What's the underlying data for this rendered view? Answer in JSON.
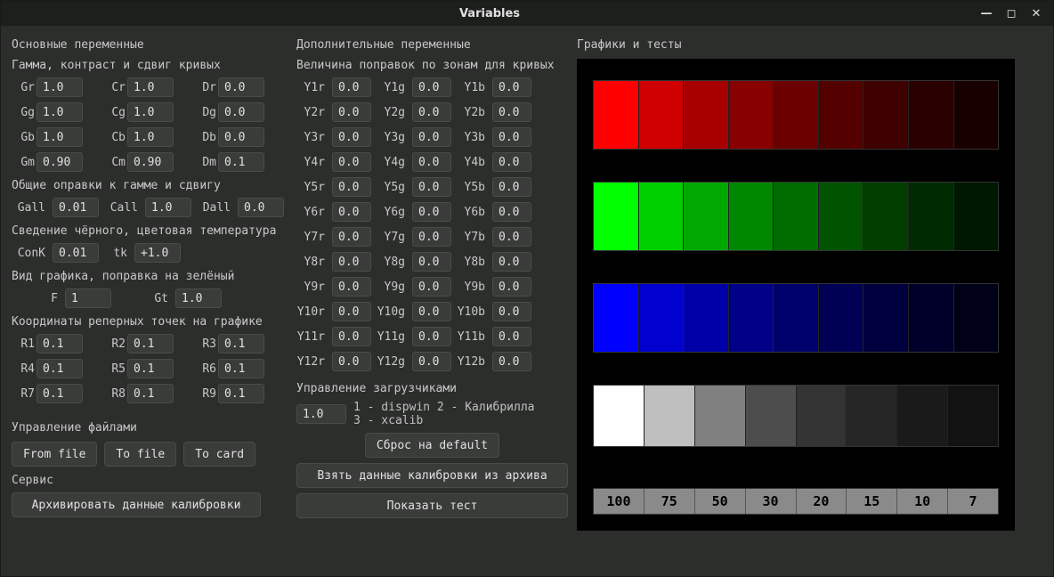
{
  "window": {
    "title": "Variables"
  },
  "col1": {
    "title": "Основные переменные",
    "gamma_title": "Гамма, контраст и сдвиг кривых",
    "gr_l": "Gr",
    "gr": "1.0",
    "cr_l": "Cr",
    "cr": "1.0",
    "dr_l": "Dr",
    "dr": "0.0",
    "gg_l": "Gg",
    "gg": "1.0",
    "cg_l": "Cg",
    "cg": "1.0",
    "dg_l": "Dg",
    "dg": "0.0",
    "gb_l": "Gb",
    "gb": "1.0",
    "cb_l": "Cb",
    "cb": "1.0",
    "db_l": "Db",
    "db": "0.0",
    "gm_l": "Gm",
    "gm": "0.90",
    "cm_l": "Cm",
    "cm": "0.90",
    "dm_l": "Dm",
    "dm": "0.1",
    "common_title": "Общие оправки к гамме и сдвигу",
    "gall_l": "Gall",
    "gall": "0.01",
    "call_l": "Call",
    "call": "1.0",
    "dall_l": "Dall",
    "dall": "0.0",
    "black_title": "Сведение чёрного, цветовая температура",
    "conk_l": "ConK",
    "conk": "0.01",
    "tk_l": "tk",
    "tk": "+1.0",
    "view_title": "Вид графика, поправка на зелёный",
    "f_l": "F",
    "f": "1",
    "gt_l": "Gt",
    "gt": "1.0",
    "coord_title": "Координаты реперных точек на графике",
    "r1_l": "R1",
    "r1": "0.1",
    "r2_l": "R2",
    "r2": "0.1",
    "r3_l": "R3",
    "r3": "0.1",
    "r4_l": "R4",
    "r4": "0.1",
    "r5_l": "R5",
    "r5": "0.1",
    "r6_l": "R6",
    "r6": "0.1",
    "r7_l": "R7",
    "r7": "0.1",
    "r8_l": "R8",
    "r8": "0.1",
    "r9_l": "R9",
    "r9": "0.1",
    "files_title": "Управление файлами",
    "from_file": "From file",
    "to_file": "To file",
    "to_card": "To card",
    "service_title": "Сервис",
    "archive_btn": "Архивировать данные калибровки"
  },
  "col2": {
    "title": "Дополнительные переменные",
    "sub": "Величина поправок по зонам для кривых",
    "rows": [
      {
        "rl": "Y1r",
        "r": "0.0",
        "gl": "Y1g",
        "g": "0.0",
        "bl": "Y1b",
        "b": "0.0"
      },
      {
        "rl": "Y2r",
        "r": "0.0",
        "gl": "Y2g",
        "g": "0.0",
        "bl": "Y2b",
        "b": "0.0"
      },
      {
        "rl": "Y3r",
        "r": "0.0",
        "gl": "Y3g",
        "g": "0.0",
        "bl": "Y3b",
        "b": "0.0"
      },
      {
        "rl": "Y4r",
        "r": "0.0",
        "gl": "Y4g",
        "g": "0.0",
        "bl": "Y4b",
        "b": "0.0"
      },
      {
        "rl": "Y5r",
        "r": "0.0",
        "gl": "Y5g",
        "g": "0.0",
        "bl": "Y5b",
        "b": "0.0"
      },
      {
        "rl": "Y6r",
        "r": "0.0",
        "gl": "Y6g",
        "g": "0.0",
        "bl": "Y6b",
        "b": "0.0"
      },
      {
        "rl": "Y7r",
        "r": "0.0",
        "gl": "Y7g",
        "g": "0.0",
        "bl": "Y7b",
        "b": "0.0"
      },
      {
        "rl": "Y8r",
        "r": "0.0",
        "gl": "Y8g",
        "g": "0.0",
        "bl": "Y8b",
        "b": "0.0"
      },
      {
        "rl": "Y9r",
        "r": "0.0",
        "gl": "Y9g",
        "g": "0.0",
        "bl": "Y9b",
        "b": "0.0"
      },
      {
        "rl": "Y10r",
        "r": "0.0",
        "gl": "Y10g",
        "g": "0.0",
        "bl": "Y10b",
        "b": "0.0"
      },
      {
        "rl": "Y11r",
        "r": "0.0",
        "gl": "Y11g",
        "g": "0.0",
        "bl": "Y11b",
        "b": "0.0"
      },
      {
        "rl": "Y12r",
        "r": "0.0",
        "gl": "Y12g",
        "g": "0.0",
        "bl": "Y12b",
        "b": "0.0"
      }
    ],
    "loaders_title": "Управление загрузчиками",
    "loader_val": "1.0",
    "loader_legend1": "1 - dispwin  2 - Калибрилла",
    "loader_legend2": "3 - xcalib",
    "reset_btn": "Сброс на default",
    "take_btn": "Взять данные калибровки из архива",
    "show_btn": "Показать тест"
  },
  "col3": {
    "title": "Графики и тесты",
    "reds": [
      "#ff0000",
      "#d00000",
      "#a80000",
      "#880000",
      "#6c0000",
      "#540000",
      "#3e0000",
      "#2a0000",
      "#180000"
    ],
    "greens": [
      "#00ff00",
      "#00d000",
      "#00a800",
      "#008800",
      "#006c00",
      "#005400",
      "#003e00",
      "#002a00",
      "#001800"
    ],
    "blues": [
      "#0000ff",
      "#0000d0",
      "#0000a8",
      "#000088",
      "#00006c",
      "#000054",
      "#00003e",
      "#00002a",
      "#000018"
    ],
    "grays": [
      "#ffffff",
      "#bfbfbf",
      "#808080",
      "#4d4d4d",
      "#333333",
      "#262626",
      "#1a1a1a",
      "#121212"
    ],
    "numbers": [
      "100",
      "75",
      "50",
      "30",
      "20",
      "15",
      "10",
      "7"
    ]
  }
}
